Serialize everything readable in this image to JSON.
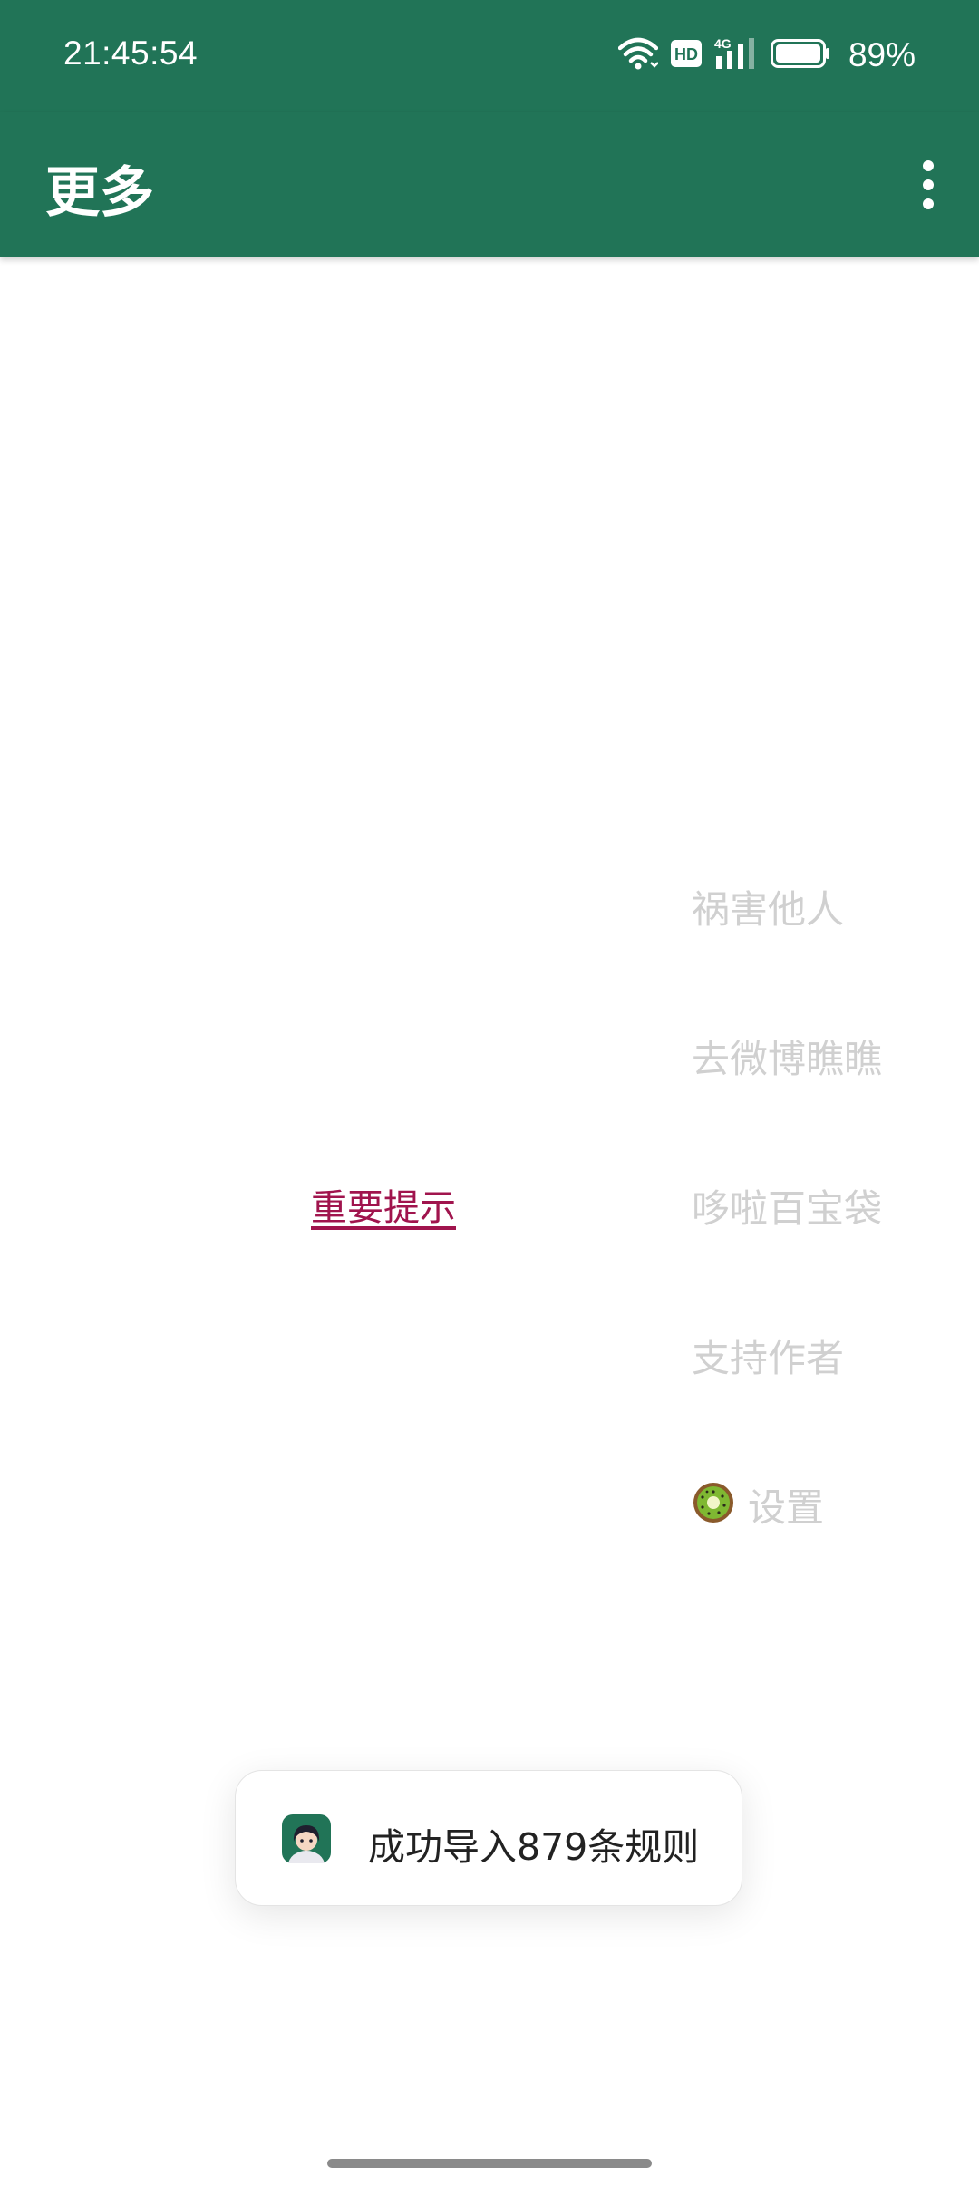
{
  "status_bar": {
    "time": "21:45:54",
    "battery_percent": "89%",
    "network": "4G",
    "hd_badge": "HD",
    "icons": [
      "wifi-icon",
      "hd-icon",
      "cellular-signal-icon",
      "battery-icon"
    ]
  },
  "app_bar": {
    "title": "更多",
    "overflow_icon": "more-vert-icon"
  },
  "menu": {
    "items": [
      {
        "label": "祸害他人"
      },
      {
        "label": "去微博瞧瞧"
      },
      {
        "label": "哆啦百宝袋"
      },
      {
        "label": "支持作者"
      },
      {
        "label": "设置",
        "icon": "kiwi-icon"
      }
    ]
  },
  "important_link": {
    "label": "重要提示"
  },
  "toast": {
    "message": "成功导入879条规则",
    "icon": "app-avatar-icon"
  },
  "colors": {
    "primary": "#217457",
    "accent_link": "#a0144d",
    "menu_text": "#d0d0d0",
    "toast_text": "#222222"
  }
}
